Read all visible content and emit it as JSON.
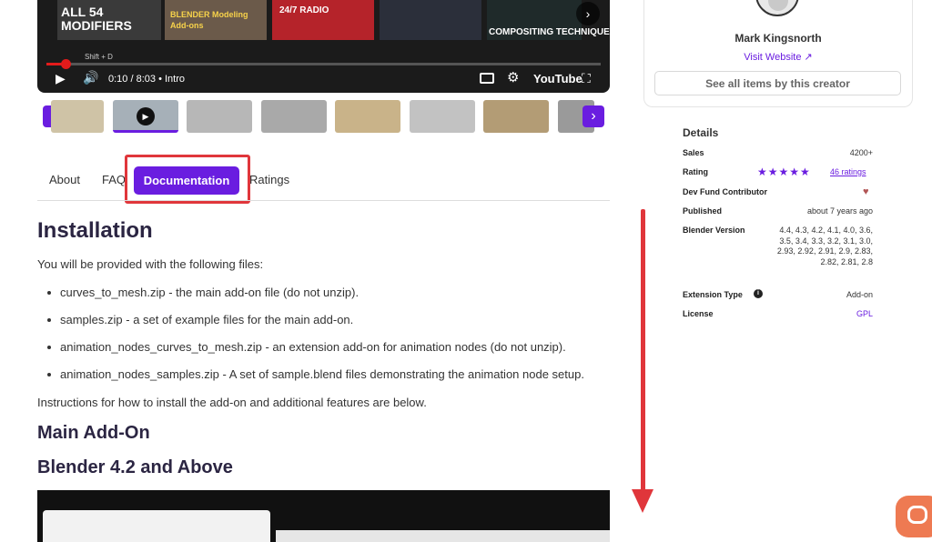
{
  "player": {
    "thumb_titles": [
      "ALL 54 MODIFIERS",
      "BLENDER Modeling Add-ons",
      "24/7 RADIO",
      "COMPOSITING TECHNIQUES"
    ],
    "shortcut": "Shift + D",
    "time": "0:10 / 8:03",
    "chapter": "Intro",
    "youtube_label": "YouTube"
  },
  "tabs": {
    "about": "About",
    "faq": "FAQ",
    "documentation": "Documentation",
    "ratings": "Ratings"
  },
  "content": {
    "h_installation": "Installation",
    "intro": "You will be provided with the following files:",
    "bullets": [
      "curves_to_mesh.zip - the main add-on file (do not unzip).",
      "samples.zip - a set of example files for the main add-on.",
      "animation_nodes_curves_to_mesh.zip - an extension add-on for animation nodes (do not unzip).",
      "animation_nodes_samples.zip - A set of sample.blend files demonstrating the animation node setup."
    ],
    "outro": "Instructions for how to install the add-on and additional features are below.",
    "h_main": "Main Add-On",
    "h_blender": "Blender 4.2 and Above"
  },
  "creator": {
    "name": "Mark Kingsnorth",
    "visit": "Visit Website",
    "see_all": "See all items by this creator"
  },
  "details": {
    "title": "Details",
    "sales_label": "Sales",
    "sales_value": "4200+",
    "rating_label": "Rating",
    "rating_link": "46 ratings",
    "rating_stars": 5,
    "devfund_label": "Dev Fund Contributor",
    "published_label": "Published",
    "published_value": "about 7 years ago",
    "blender_label": "Blender Version",
    "blender_value": "4.4, 4.3, 4.2, 4.1, 4.0, 3.6, 3.5, 3.4, 3.3, 3.2, 3.1, 3.0, 2.93, 2.92, 2.91, 2.9, 2.83, 2.82, 2.81, 2.8",
    "ext_label": "Extension Type",
    "ext_value": "Add-on",
    "license_label": "License",
    "license_value": "GPL"
  },
  "colors": {
    "accent": "#6a1de0",
    "annotation": "#e0363b",
    "chat": "#ee7a52"
  }
}
